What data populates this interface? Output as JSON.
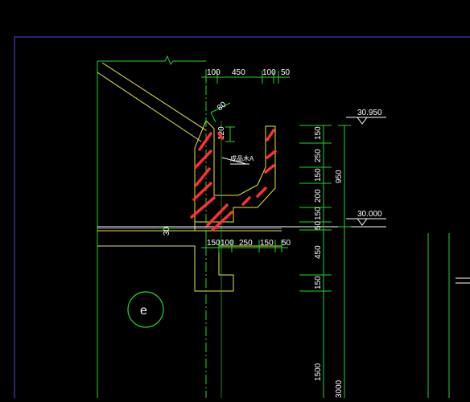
{
  "colors": {
    "background": "#000000",
    "frame": "#4b4bd0",
    "green": "#28d428",
    "yellow": "#e6e64a",
    "white": "#ffffff",
    "red": "#ff3030"
  },
  "drawing": {
    "top_dims": [
      "100",
      "450",
      "100",
      "50"
    ],
    "bottom_dims": [
      "150",
      "100",
      "250",
      "150",
      "50"
    ],
    "vertical_dims": [
      "150",
      "250",
      "150",
      "200",
      "150",
      "50",
      "450",
      "150",
      "1500"
    ],
    "overall_height": "950",
    "bottom_overall": "3000",
    "slope_thickness": "80",
    "gutter_dim": "120",
    "left_offset": "30",
    "elevation_top": "30.950",
    "elevation_bottom": "30.000",
    "annotation": "成品木A",
    "grid_axis": "e"
  }
}
